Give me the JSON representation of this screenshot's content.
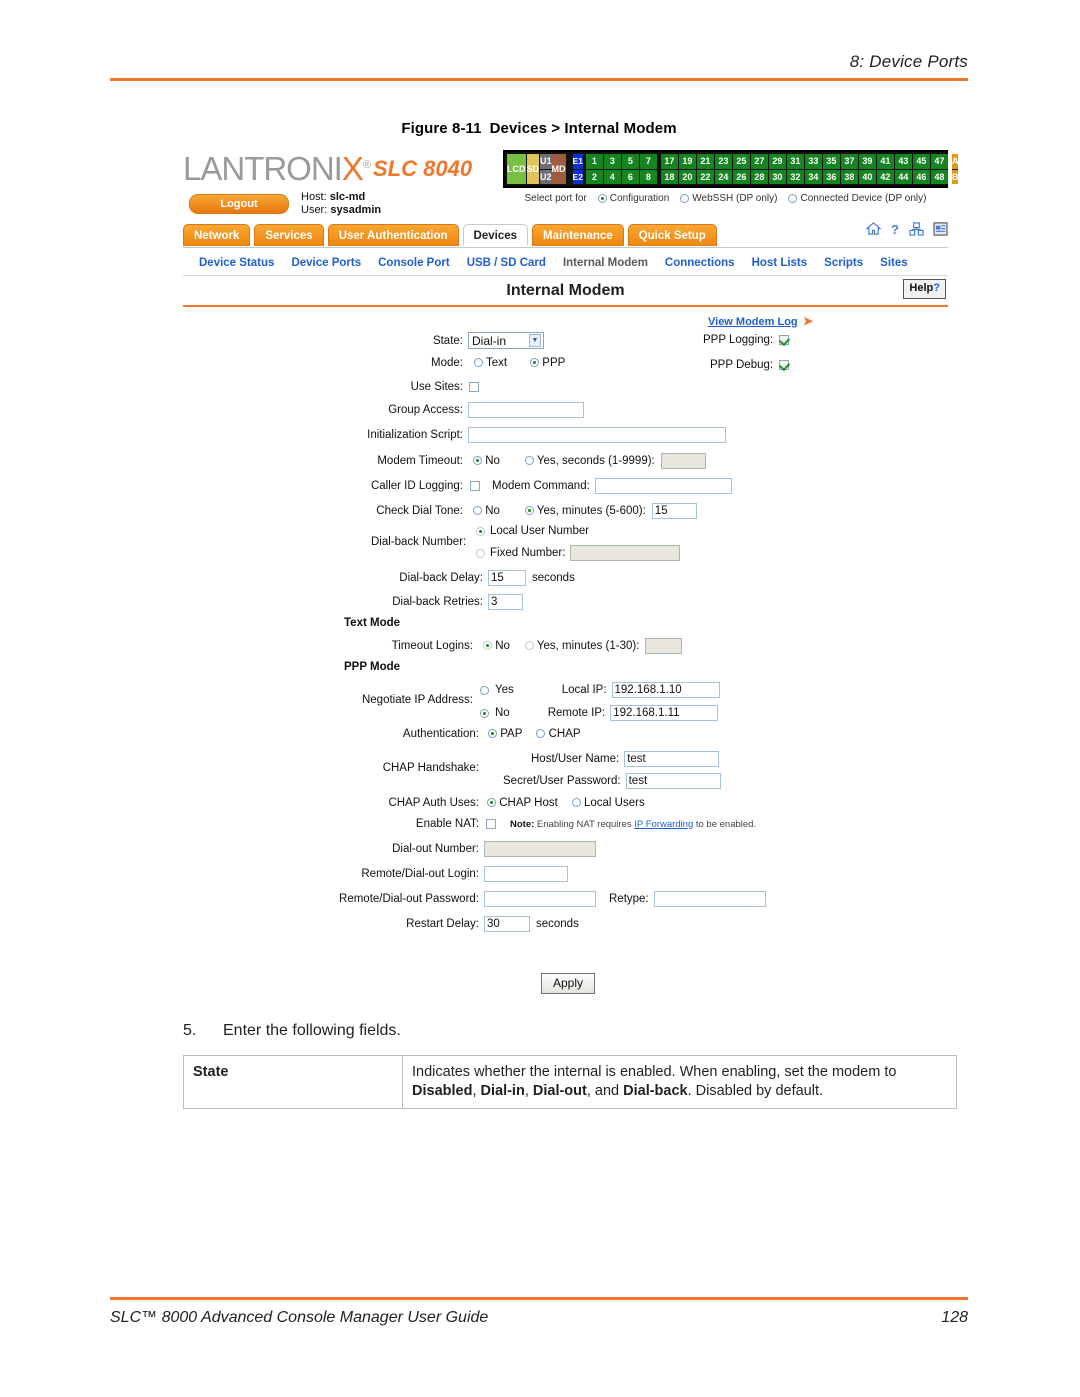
{
  "doc": {
    "running_header": "8: Device Ports",
    "figure_caption_num": "Figure 8-11",
    "figure_caption_text": "Devices > Internal Modem",
    "footer_left": "SLC™ 8000 Advanced Console Manager User Guide",
    "footer_page": "128"
  },
  "app": {
    "logo_text": "LANTRONI",
    "logo_x": "X",
    "logo_reg": "®",
    "model": "SLC 8040",
    "logout_label": "Logout",
    "host_label": "Host:",
    "host_value": "slc-md",
    "user_label": "User:",
    "user_value": "sysadmin",
    "accent_orange": "#f0762b",
    "link_blue": "#1f5fd0"
  },
  "device_panel": {
    "status_cells": [
      "LCD",
      "SD"
    ],
    "usb_cells": [
      "U1",
      "U2"
    ],
    "md_cell": "MD",
    "eth_cells": [
      "E1",
      "E2"
    ],
    "ports_group1_top": [
      "1",
      "3",
      "5",
      "7"
    ],
    "ports_group1_bottom": [
      "2",
      "4",
      "6",
      "8"
    ],
    "ports_group2_top": [
      "17",
      "19",
      "21",
      "23",
      "25",
      "27",
      "29",
      "31",
      "33",
      "35",
      "37",
      "39",
      "41",
      "43",
      "45",
      "47"
    ],
    "ports_group2_bottom": [
      "18",
      "20",
      "22",
      "24",
      "26",
      "28",
      "30",
      "32",
      "34",
      "36",
      "38",
      "40",
      "42",
      "44",
      "46",
      "48"
    ],
    "ab_cells": [
      "A",
      "B"
    ],
    "select_port_label": "Select port for",
    "select_options": [
      {
        "label": "Configuration",
        "selected": true
      },
      {
        "label": "WebSSH (DP only)",
        "selected": false
      },
      {
        "label": "Connected Device (DP only)",
        "selected": false
      }
    ]
  },
  "nav": {
    "tabs": [
      {
        "label": "Network",
        "active": false
      },
      {
        "label": "Services",
        "active": false
      },
      {
        "label": "User Authentication",
        "active": false
      },
      {
        "label": "Devices",
        "active": true
      },
      {
        "label": "Maintenance",
        "active": false
      },
      {
        "label": "Quick Setup",
        "active": false
      }
    ],
    "icons": [
      "home-icon",
      "help-question-icon",
      "sitemap-icon",
      "document-icon"
    ],
    "subnav": [
      {
        "label": "Device Status",
        "current": false
      },
      {
        "label": "Device Ports",
        "current": false
      },
      {
        "label": "Console Port",
        "current": false
      },
      {
        "label": "USB / SD Card",
        "current": false
      },
      {
        "label": "Internal Modem",
        "current": true
      },
      {
        "label": "Connections",
        "current": false
      },
      {
        "label": "Host Lists",
        "current": false
      },
      {
        "label": "Scripts",
        "current": false
      },
      {
        "label": "Sites",
        "current": false
      }
    ]
  },
  "page": {
    "title": "Internal Modem",
    "help_label": "Help",
    "help_mark": "?",
    "view_modem_log": "View Modem Log"
  },
  "form": {
    "state_label": "State:",
    "state_value": "Dial-in",
    "mode_label": "Mode:",
    "mode_text": "Text",
    "mode_ppp": "PPP",
    "use_sites_label": "Use Sites:",
    "group_access_label": "Group Access:",
    "group_access_value": "",
    "init_script_label": "Initialization Script:",
    "init_script_value": "",
    "modem_timeout_label": "Modem Timeout:",
    "modem_timeout_no": "No",
    "modem_timeout_yes": "Yes, seconds (1-9999):",
    "modem_timeout_value": "",
    "caller_id_label": "Caller ID Logging:",
    "modem_command_label": "Modem Command:",
    "modem_command_value": "",
    "check_dial_tone_label": "Check Dial Tone:",
    "check_dial_tone_no": "No",
    "check_dial_tone_yes": "Yes, minutes (5-600):",
    "check_dial_tone_value": "15",
    "dialback_number_label": "Dial-back Number:",
    "dialback_local": "Local User Number",
    "dialback_fixed": "Fixed Number:",
    "dialback_fixed_value": "",
    "dialback_delay_label": "Dial-back Delay:",
    "dialback_delay_value": "15",
    "dialback_delay_unit": "seconds",
    "dialback_retries_label": "Dial-back Retries:",
    "dialback_retries_value": "3",
    "text_mode_heading": "Text Mode",
    "timeout_logins_label": "Timeout Logins:",
    "timeout_logins_no": "No",
    "timeout_logins_yes": "Yes, minutes (1-30):",
    "timeout_logins_value": "",
    "ppp_mode_heading": "PPP Mode",
    "negotiate_label": "Negotiate IP Address:",
    "negotiate_yes": "Yes",
    "negotiate_no": "No",
    "local_ip_label": "Local IP:",
    "local_ip_value": "192.168.1.10",
    "remote_ip_label": "Remote IP:",
    "remote_ip_value": "192.168.1.11",
    "authentication_label": "Authentication:",
    "auth_pap": "PAP",
    "auth_chap": "CHAP",
    "chap_handshake_label": "CHAP Handshake:",
    "host_user_name_label": "Host/User Name:",
    "host_user_name_value": "test",
    "secret_user_password_label": "Secret/User Password:",
    "secret_user_password_value": "test",
    "chap_auth_uses_label": "CHAP Auth Uses:",
    "chap_auth_host": "CHAP Host",
    "chap_auth_local": "Local Users",
    "enable_nat_label": "Enable NAT:",
    "nat_note_bold": "Note:",
    "nat_note_pre": " Enabling NAT requires ",
    "nat_note_link": "IP Forwarding",
    "nat_note_post": " to be enabled.",
    "dialout_number_label": "Dial-out Number:",
    "dialout_number_value": "",
    "remote_dialout_login_label": "Remote/Dial-out Login:",
    "remote_dialout_login_value": "",
    "remote_dialout_password_label": "Remote/Dial-out Password:",
    "remote_dialout_password_value": "",
    "retype_label": "Retype:",
    "retype_value": "",
    "restart_delay_label": "Restart Delay:",
    "restart_delay_value": "30",
    "restart_delay_unit": "seconds",
    "apply_label": "Apply"
  },
  "body_text": {
    "step_number": "5.",
    "step_text": "Enter the following fields.",
    "table": [
      {
        "key": "State",
        "line1": "Indicates whether the internal is enabled. When enabling, set the modem to",
        "line2_b1": "Disabled",
        "line2_s1": ", ",
        "line2_b2": "Dial-in",
        "line2_s2": ", ",
        "line2_b3": "Dial-out",
        "line2_s3": ", and ",
        "line2_b4": "Dial-back",
        "line2_s4": ". Disabled by default."
      }
    ]
  }
}
